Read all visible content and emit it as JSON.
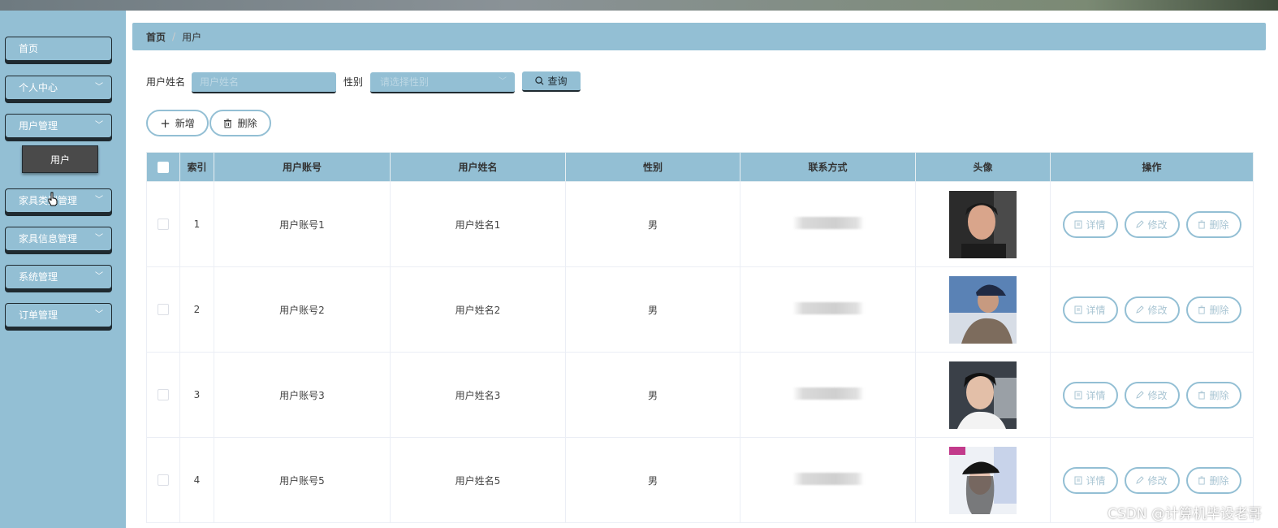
{
  "sidebar": {
    "items": [
      {
        "label": "首页",
        "has_chevron": false
      },
      {
        "label": "个人中心",
        "has_chevron": true
      },
      {
        "label": "用户管理",
        "has_chevron": true
      },
      {
        "label": "家具类型管理",
        "has_chevron": true
      },
      {
        "label": "家具信息管理",
        "has_chevron": true
      },
      {
        "label": "系统管理",
        "has_chevron": true
      },
      {
        "label": "订单管理",
        "has_chevron": true
      }
    ],
    "submenu_active": "用户"
  },
  "breadcrumb": {
    "home": "首页",
    "separator": "/",
    "current": "用户"
  },
  "search": {
    "name_label": "用户姓名",
    "name_placeholder": "用户姓名",
    "gender_label": "性别",
    "gender_placeholder": "请选择性别",
    "query_button": "查询"
  },
  "actions": {
    "add": "新增",
    "delete": "删除"
  },
  "table": {
    "headers": [
      "索引",
      "用户账号",
      "用户姓名",
      "性别",
      "联系方式",
      "头像",
      "操作"
    ],
    "rows": [
      {
        "index": "1",
        "account": "用户账号1",
        "name": "用户姓名1",
        "gender": "男"
      },
      {
        "index": "2",
        "account": "用户账号2",
        "name": "用户姓名2",
        "gender": "男"
      },
      {
        "index": "3",
        "account": "用户账号3",
        "name": "用户姓名3",
        "gender": "男"
      },
      {
        "index": "4",
        "account": "用户账号5",
        "name": "用户姓名5",
        "gender": "男"
      }
    ],
    "row_actions": {
      "detail": "详情",
      "edit": "修改",
      "delete": "删除"
    }
  },
  "watermark": "CSDN @计算机毕设老哥",
  "colors": {
    "accent": "#93bfd4",
    "dark": "#1f2a30",
    "submenu_bg": "#4a4a4a"
  }
}
